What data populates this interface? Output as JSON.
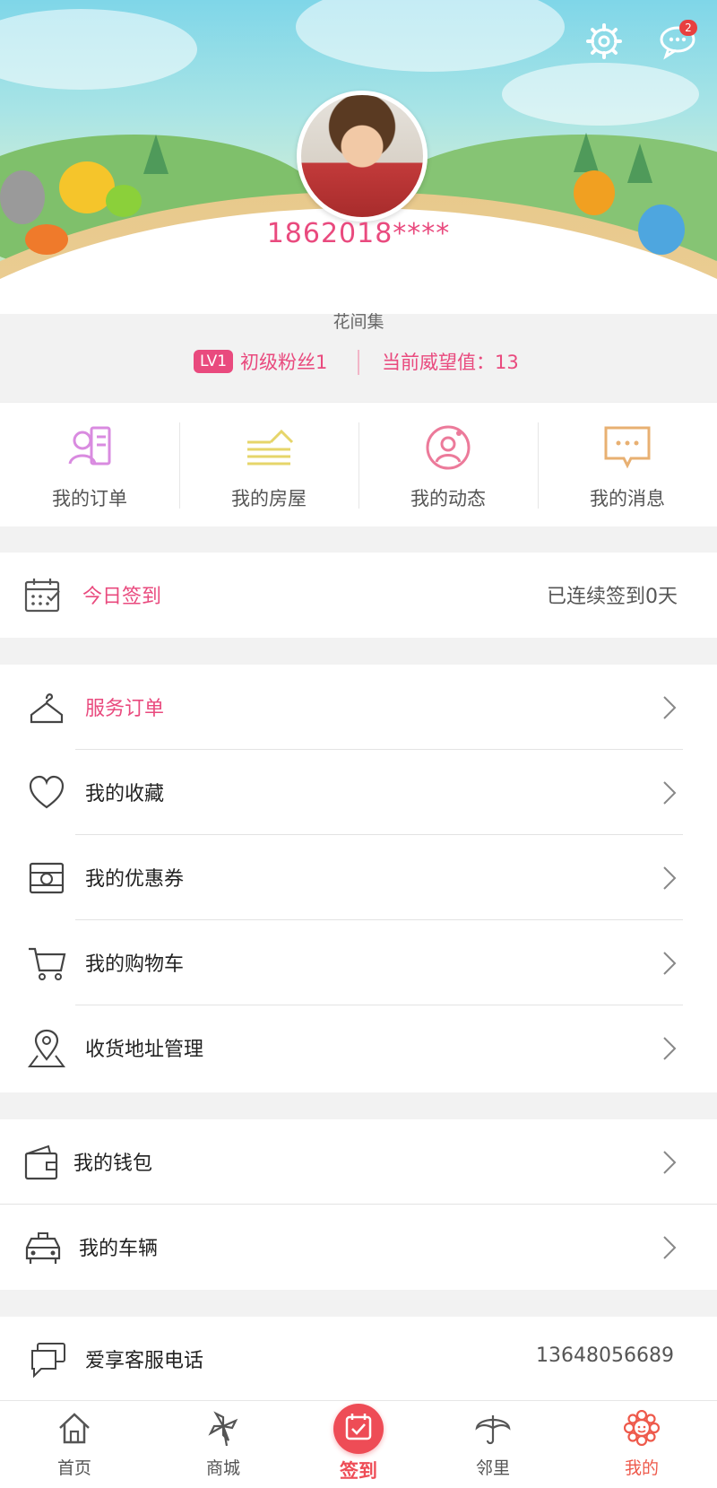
{
  "header": {
    "notification_count": "2",
    "username": "1862018****",
    "community": "花间集",
    "level_badge": "LV1",
    "level_name": "初级粉丝1",
    "reputation": "当前威望值：13"
  },
  "quick_actions": [
    {
      "label": "我的订单",
      "icon": "order-icon",
      "color": "#d98be0"
    },
    {
      "label": "我的房屋",
      "icon": "house-icon",
      "color": "#e6d56a"
    },
    {
      "label": "我的动态",
      "icon": "activity-icon",
      "color": "#ec7a9a"
    },
    {
      "label": "我的消息",
      "icon": "message-icon",
      "color": "#e8b072"
    }
  ],
  "checkin": {
    "label": "今日签到",
    "streak": "已连续签到0天"
  },
  "menu1": [
    {
      "label": "服务订单",
      "icon": "hanger-icon"
    },
    {
      "label": "我的收藏",
      "icon": "heart-icon"
    },
    {
      "label": "我的优惠券",
      "icon": "coupon-icon"
    },
    {
      "label": "我的购物车",
      "icon": "cart-icon"
    },
    {
      "label": "收货地址管理",
      "icon": "location-icon"
    }
  ],
  "menu2": [
    {
      "label": "我的钱包",
      "icon": "wallet-icon"
    },
    {
      "label": "我的车辆",
      "icon": "car-icon"
    }
  ],
  "service": {
    "label": "爱享客服电话",
    "phone": "13648056689"
  },
  "nav": [
    {
      "label": "首页",
      "icon": "home-icon"
    },
    {
      "label": "商城",
      "icon": "pinwheel-icon"
    },
    {
      "label": "签到",
      "icon": "checkin-icon"
    },
    {
      "label": "邻里",
      "icon": "umbrella-icon"
    },
    {
      "label": "我的",
      "icon": "flower-icon"
    }
  ],
  "colors": {
    "accent": "#e94a7e",
    "checkin_red": "#ee4c56"
  }
}
